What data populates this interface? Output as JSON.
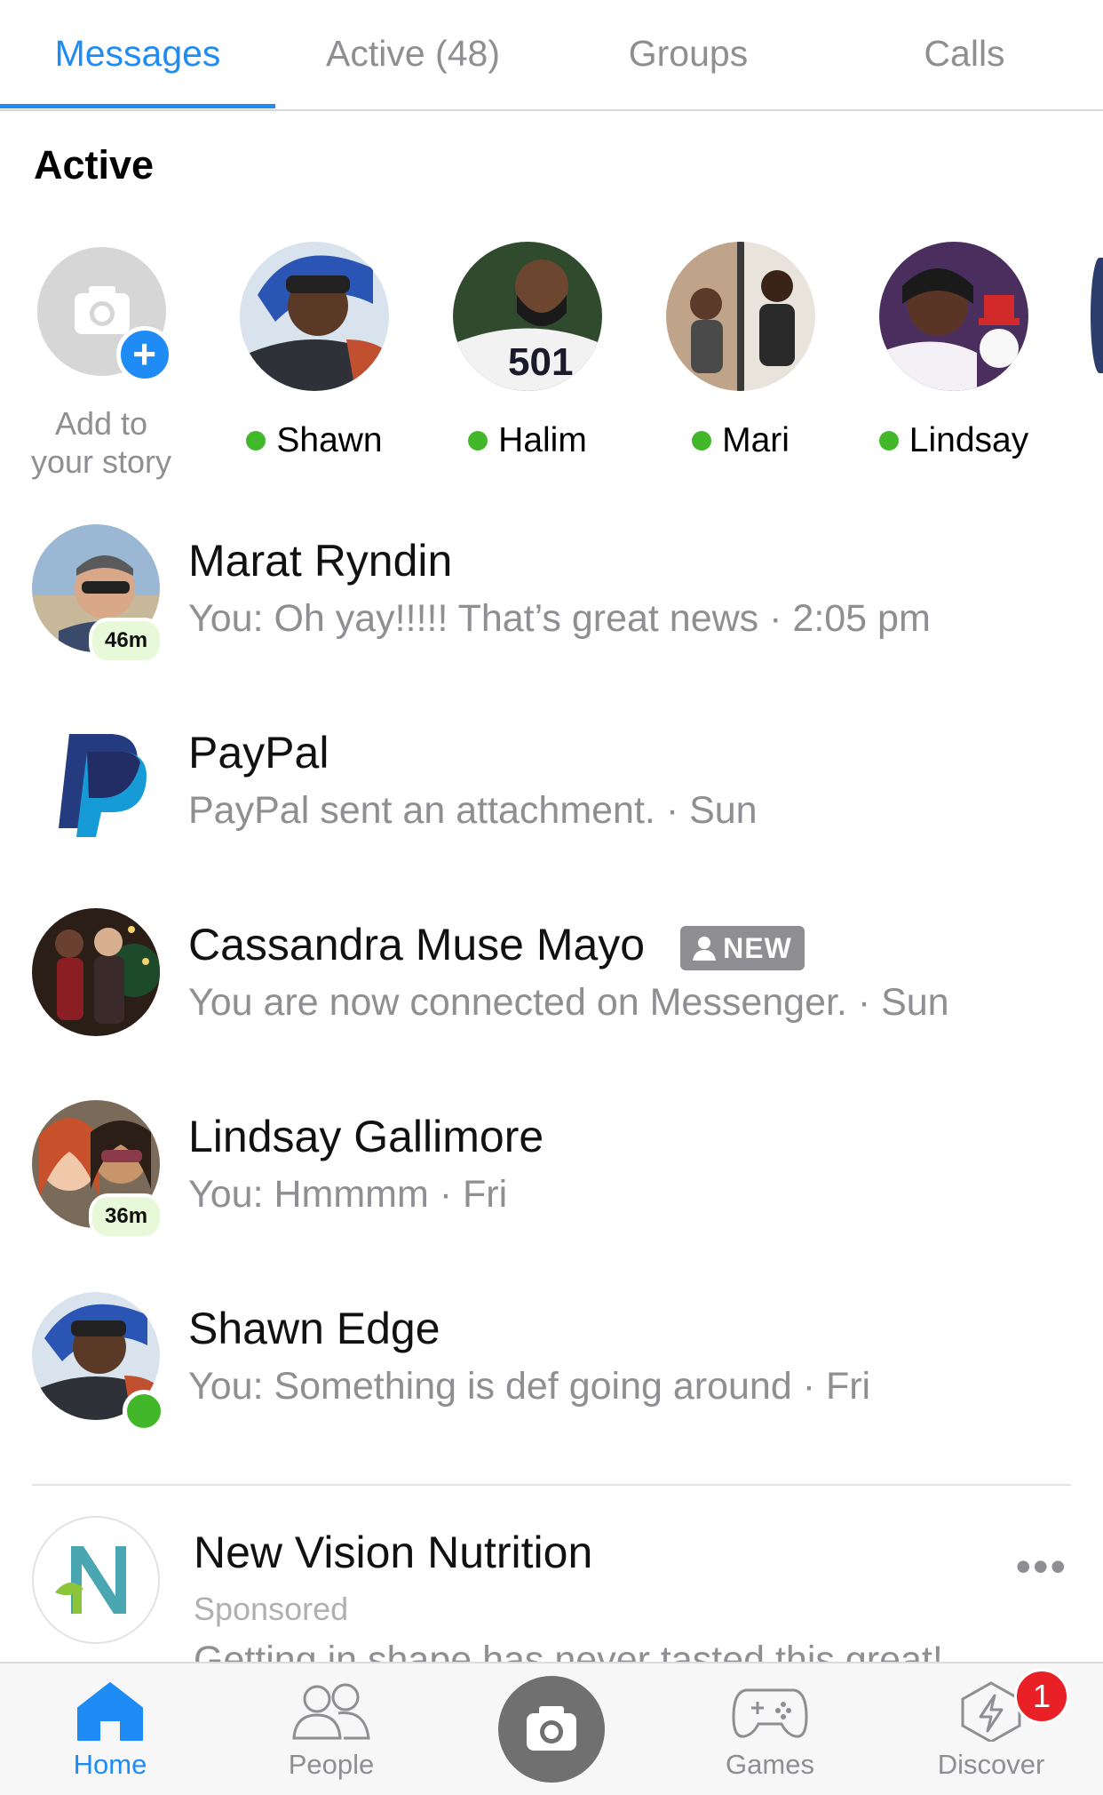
{
  "tabs": [
    {
      "label": "Messages",
      "active": true
    },
    {
      "label": "Active (48)",
      "active": false
    },
    {
      "label": "Groups",
      "active": false
    },
    {
      "label": "Calls",
      "active": false
    }
  ],
  "active_section": {
    "heading": "Active",
    "add_story_label_line1": "Add to",
    "add_story_label_line2": "your story",
    "people": [
      {
        "name": "Shawn"
      },
      {
        "name": "Halim"
      },
      {
        "name": "Mari"
      },
      {
        "name": "Lindsay"
      }
    ]
  },
  "conversations": [
    {
      "name": "Marat Ryndin",
      "preview": "You: Oh yay!!!!! That’s great news · 2:05 pm",
      "active_ago": "46m"
    },
    {
      "name": "PayPal",
      "preview": "PayPal sent an attachment. · Sun"
    },
    {
      "name": "Cassandra Muse Mayo",
      "badge": "NEW",
      "preview": "You are now connected on Messenger. · Sun"
    },
    {
      "name": "Lindsay Gallimore",
      "preview": "You: Hmmmm · Fri",
      "active_ago": "36m"
    },
    {
      "name": "Shawn Edge",
      "preview": "You: Something is def going around · Fri",
      "online": true
    }
  ],
  "ad": {
    "name": "New Vision Nutrition",
    "sponsored": "Sponsored",
    "body": "Getting in shape has never tasted this great!",
    "more_label": "•••"
  },
  "tabbar": {
    "home": "Home",
    "people": "People",
    "games": "Games",
    "discover": "Discover",
    "discover_count": "1"
  },
  "colors": {
    "accent": "#1f8cf5",
    "online": "#42b72a",
    "secondary_text": "#8e8e93",
    "notification": "#ea2027"
  }
}
